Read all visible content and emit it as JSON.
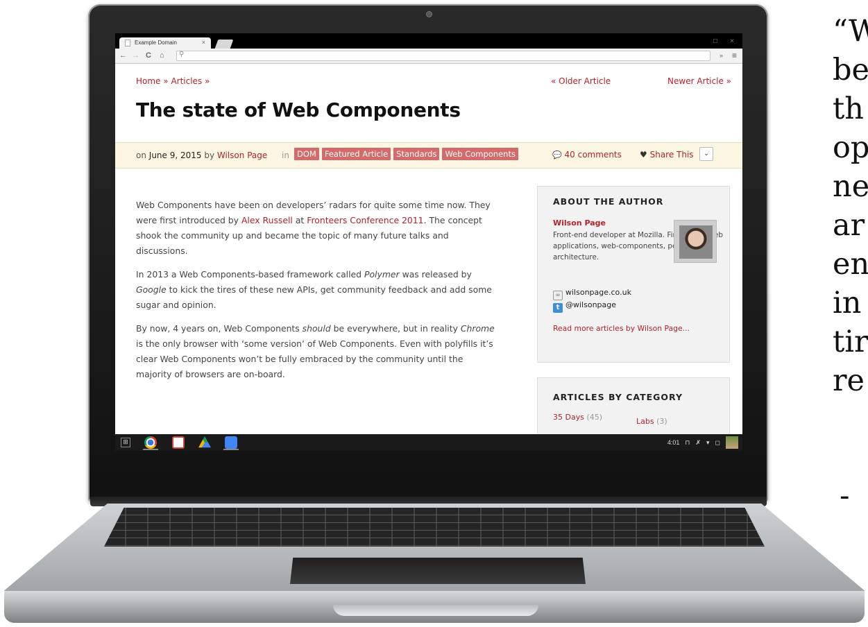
{
  "browser": {
    "tab_title": "Example Domain",
    "tab_close": "×",
    "back_icon": "←",
    "forward_icon": "→",
    "reload_icon": "C",
    "home_icon": "⌂",
    "search_icon": "⚲",
    "extensions_icon": "»",
    "menu_icon": "≡",
    "minimize_icon": "□",
    "close_icon": "×"
  },
  "page": {
    "breadcrumb": {
      "home": "Home",
      "sep": "»",
      "articles": "Articles"
    },
    "older_article": "« Older Article",
    "newer_article": "Newer Article »",
    "title": "The state of Web Components",
    "meta": {
      "on": "on",
      "date": "June 9, 2015",
      "by": "by",
      "author": "Wilson Page",
      "in": "in",
      "tags": [
        "DOM",
        "Featured Article",
        "Standards",
        "Web Components"
      ],
      "comments": "40 comments",
      "share": "Share This",
      "share_dropdown_icon": "⌄"
    },
    "article": {
      "p1_a": "Web Components have been on developers’ radars for quite some time now. They were first introduced by ",
      "p1_link1": "Alex Russell",
      "p1_b": " at ",
      "p1_link2": "Fronteers Conference 2011",
      "p1_c": ". The concept shook the community up and became the topic of many future talks and discussions.",
      "p2_a": "In 2013 a Web Components-based framework called ",
      "p2_em1": "Polymer",
      "p2_b": " was released by ",
      "p2_em2": "Google",
      "p2_c": " to kick the tires of these new APIs, get community feedback and add some sugar and opinion.",
      "p3_a": "By now, 4 years on, Web Components ",
      "p3_em1": "should",
      "p3_b": " be everywhere, but in reality ",
      "p3_em2": "Chrome",
      "p3_c": " is the only browser with ‘some version’ of Web Components. Even with polyfills it’s clear Web Components won’t be fully embraced by the community until the majority of browsers are on-board."
    },
    "about_author": {
      "heading": "ABOUT THE AUTHOR",
      "name": "Wilson Page",
      "bio": "Front-end developer at Mozilla. Firefox OS, web applications, web-components, performance, architecture.",
      "website": "wilsonpage.co.uk",
      "twitter": "@wilsonpage",
      "read_more": "Read more articles by Wilson Page..."
    },
    "categories": {
      "heading": "ARTICLES BY CATEGORY",
      "items": [
        {
          "label": "35 Days",
          "count": "(45)"
        },
        {
          "label": "Labs",
          "count": "(3)"
        }
      ]
    }
  },
  "shelf": {
    "launcher_icon": "⊞",
    "time": "4:01",
    "tray_icons": [
      "⊓",
      "✗",
      "▾",
      "◻"
    ]
  },
  "quote": {
    "lines": [
      "“W",
      "be",
      "th",
      "op",
      "ne",
      "ar",
      "en",
      "in",
      "tir",
      "re"
    ],
    "attribution": "-"
  }
}
